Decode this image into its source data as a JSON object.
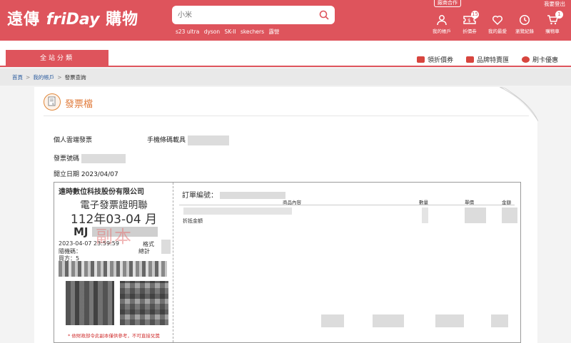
{
  "header": {
    "logo_prefix": "遠傳",
    "logo_brand": "friDay",
    "logo_suffix": "購物",
    "search_placeholder": "小米",
    "hot_keywords": [
      "s23 ultra",
      "dyson",
      "SK-II",
      "skechers",
      "露營"
    ],
    "vendor_label": "廠商合作",
    "login_label": "我要登出",
    "icons": [
      {
        "name": "account",
        "label": "我的帳戶",
        "badge": ""
      },
      {
        "name": "coupon",
        "label": "折價券",
        "badge": "15"
      },
      {
        "name": "wishlist",
        "label": "我的最愛",
        "badge": ""
      },
      {
        "name": "history",
        "label": "瀏覽紀錄",
        "badge": ""
      },
      {
        "name": "cart",
        "label": "購物車",
        "badge": "1"
      }
    ]
  },
  "navbar": {
    "category_label": "全站分類",
    "quick_links": [
      "領折價券",
      "品牌特賣匯",
      "刷卡優惠"
    ]
  },
  "breadcrumb": [
    "首頁",
    "我的帳戶",
    "發票查詢"
  ],
  "panel": {
    "title": "發票檔",
    "cloud_invoice_label": "個人雲端發票",
    "carrier_label": "手機條碼載具",
    "invoice_number_label": "發票號碼",
    "issue_date_label": "開立日期",
    "issue_date": "2023/04/07"
  },
  "invoice": {
    "company": "遠時數位科技股份有限公司",
    "doc_title": "電子發票證明聯",
    "period": "112年03-04 月",
    "number_prefix": "MJ",
    "stamp_text": "副本",
    "datetime": "2023-04-07 23:59:59",
    "format_label": "格式",
    "random_label": "隨機碼：",
    "total_label": "總計",
    "buyer_label": "買方：5",
    "note": "* 依財政部令此副本僅供參考，不可直接兌獎"
  },
  "order": {
    "order_label": "訂單編號：",
    "columns": [
      "商品內容",
      "數量",
      "單價",
      "金額"
    ],
    "discount_label": "折抵金額"
  },
  "colors": {
    "brand": "#de545c",
    "accent": "#e07a3a",
    "note": "#d03030"
  }
}
